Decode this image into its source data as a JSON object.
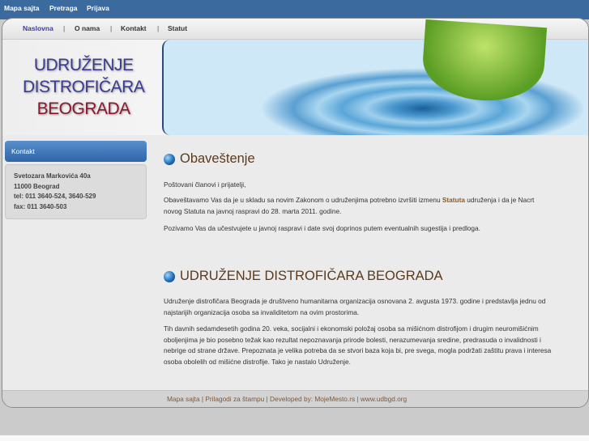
{
  "topbar": {
    "links": [
      "Mapa sajta",
      "Pretraga",
      "Prijava"
    ]
  },
  "nav": {
    "items": [
      "Naslovna",
      "O nama",
      "Kontakt",
      "Statut"
    ],
    "separator": "|"
  },
  "logo": {
    "line1": "UDRUŽENJE",
    "line2": "DISTROFIČARA",
    "line3": "BEOGRADA"
  },
  "sidebar": {
    "title": "Kontakt",
    "lines": [
      "Svetozara Markovića 40a",
      "11000 Beograd",
      "tel: 011 3640-524, 3640-529",
      "fax: 011 3640-503"
    ]
  },
  "notice": {
    "title": "Obaveštenje",
    "p1": "Poštovani članovi i prijatelji,",
    "p2a": "Obaveštavamo Vas da je u skladu sa novim Zakonom o udruženjima potrebno izvršiti izmenu ",
    "p2link": "Statuta",
    "p2b": " udruženja i da je Nacrt novog Statuta na javnoj raspravi do 28. marta 2011. godine.",
    "p3": "Pozivamo Vas da učestvujete u javnoj raspravi i date svoj doprinos putem eventualnih sugestija i predloga."
  },
  "about": {
    "title": "UDRUŽENJE DISTROFIČARA BEOGRADA",
    "p1": "Udruženje distrofičara Beograda je društveno humanitarna organizacija osnovana 2. avgusta 1973. godine i predstavlja jednu od najstarijih organizacija osoba sa invaliditetom na ovim prostorima.",
    "p2": "Tih davnih sedamdesetih godina 20. veka, socijalni i ekonomski položaj osoba sa mišićnom distrofijom i drugim neuromišićnim oboljenjima je bio posebno težak kao rezultat nepoznavanja prirode bolesti, nerazumevanja sredine, predrasuda o invalidnosti i nebrige od strane države. Prepoznata je velika potreba da se stvori baza koja bi, pre svega, mogla podržati zaštitu prava i interesa osoba obolelih od mišićne distrofije. Tako je nastalo Udruženje."
  },
  "footer": {
    "items": [
      "Mapa sajta",
      "Prilagodi za štampu",
      "Developed by: MojeMesto.rs",
      "www.udbgd.org"
    ],
    "separator": " | "
  }
}
